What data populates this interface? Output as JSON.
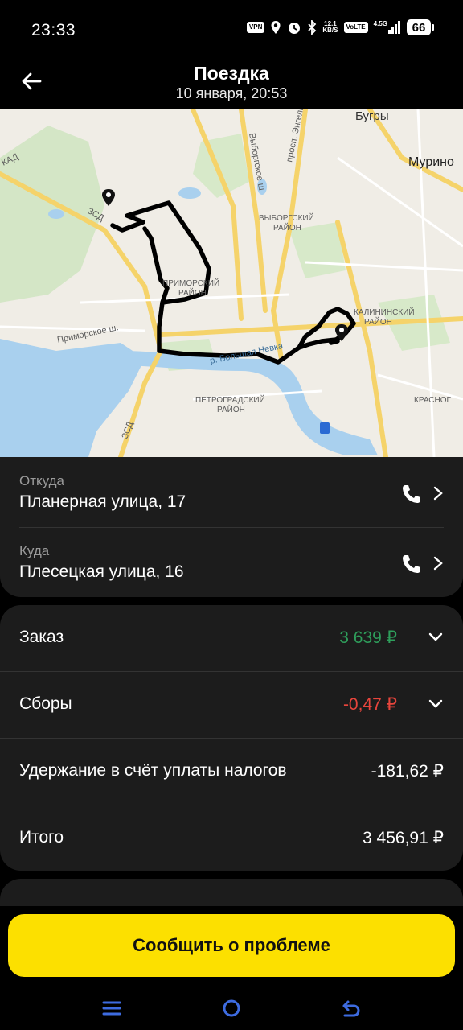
{
  "status_bar": {
    "time": "23:33",
    "vpn": "VPN",
    "net_speed_top": "12.1",
    "net_speed_bottom": "KB/S",
    "volte": "VoLTE",
    "network": "4.5G",
    "battery": "66"
  },
  "header": {
    "title": "Поездка",
    "subtitle": "10 января, 20:53"
  },
  "map": {
    "labels": {
      "bugry": "Бугры",
      "murino": "Мурино",
      "vyborgskoe": "Выборгское ш.",
      "engelsa": "просп. Энгельса",
      "vyborgsky_1": "ВЫБОРГСКИЙ",
      "vyborgsky_2": "РАЙОН",
      "primorsky_1": "ПРИМОРСКИЙ",
      "primorsky_2": "РАЙОН",
      "kalininsky_1": "КАЛИНИНСКИЙ",
      "kalininsky_2": "РАЙОН",
      "petrogradsky_1": "ПЕТРОГРАДСКИЙ",
      "petrogradsky_2": "РАЙОН",
      "krasnogv": "КРАСНОГ",
      "primorskoe": "Приморское ш.",
      "zsd_1": "ЗСД",
      "zsd_2": "ЗСД",
      "kad": "КАД",
      "nevka": "р. Большая Невка"
    }
  },
  "from": {
    "label": "Откуда",
    "address": "Планерная улица, 17"
  },
  "to": {
    "label": "Куда",
    "address": "Плесецкая улица, 16"
  },
  "finance": {
    "order_label": "Заказ",
    "order_value": "3 639 ₽",
    "fees_label": "Сборы",
    "fees_value": "-0,47 ₽",
    "tax_label": "Удержание в счёт уплаты налогов",
    "tax_value": "-181,62 ₽",
    "total_label": "Итого",
    "total_value": "3 456,91 ₽"
  },
  "report_button": "Сообщить о проблеме",
  "colors": {
    "accent_yellow": "#fce000",
    "positive": "#2e9e5b",
    "negative": "#e8453c",
    "card_bg": "#1c1c1c"
  },
  "icons": {
    "back": "arrow-left-icon",
    "phone": "phone-icon",
    "chevron_right": "chevron-right-icon",
    "chevron_down": "chevron-down-icon",
    "pin": "map-pin-icon",
    "nav_menu": "menu-icon",
    "nav_home": "home-icon",
    "nav_back": "back-icon"
  }
}
